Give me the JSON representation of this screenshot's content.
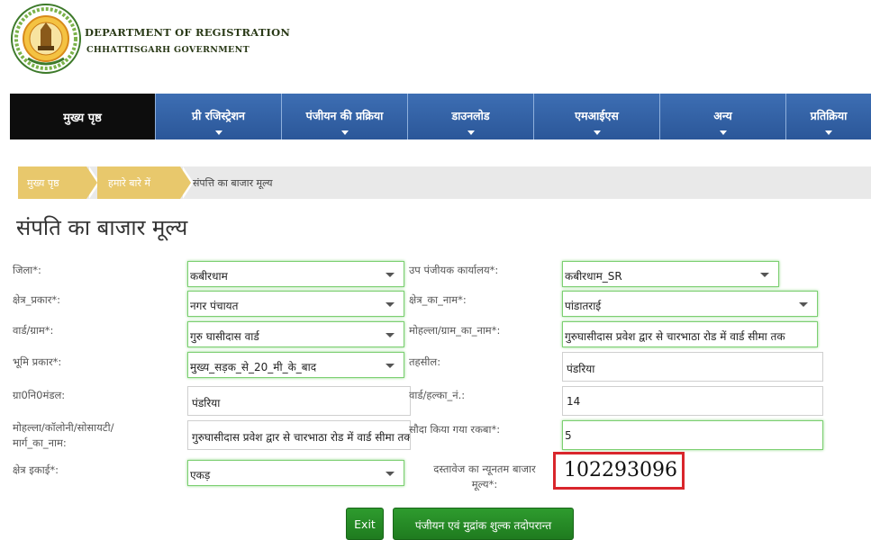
{
  "header": {
    "logo_text": "छत्तीसगढ़ शासन",
    "dept_title": "DEPARTMENT OF REGISTRATION",
    "dept_sub": "CHHATTISGARH GOVERNMENT"
  },
  "nav": {
    "items": [
      {
        "label": "मुख्य पृष्ठ"
      },
      {
        "label": "प्री रजिस्ट्रेशन"
      },
      {
        "label": "पंजीयन की प्रक्रिया"
      },
      {
        "label": "डाउनलोड"
      },
      {
        "label": "एमआईएस"
      },
      {
        "label": "अन्य"
      },
      {
        "label": "प्रतिक्रिया"
      }
    ]
  },
  "breadcrumb": {
    "home": "मुख्य पृष्ठ",
    "about": "हमारे बारे में",
    "current": "संपत्ति का बाजार मूल्य"
  },
  "page_title": "संपति का बाजार मूल्य",
  "form": {
    "district_label": "जिला*:",
    "district_value": "कबीरधाम",
    "sub_registrar_label": "उप पंजीयक कार्यालय*:",
    "sub_registrar_value": "कबीरधाम_SR",
    "area_type_label": "क्षेत्र_प्रकार*:",
    "area_type_value": "नगर पंचायत",
    "area_name_label": "क्षेत्र_का_नाम*:",
    "area_name_value": "पांडातराई",
    "ward_label": "वार्ड/ग्राम*:",
    "ward_value": "गुरु घासीदास वार्ड",
    "mohalla_label": "मोहल्ला/ग्राम_का_नाम*:",
    "mohalla_value": "गुरुघासीदास प्रवेश द्वार से चारभाठा रोड में वार्ड सीमा तक",
    "land_type_label": "भूमि प्रकार*:",
    "land_type_value": "मुख्य_सड़क_से_20_मी_के_बाद",
    "tehsil_label": "तहसील:",
    "tehsil_value": "पंडरिया",
    "village_label": "ग्रा0नि0मंडल:",
    "village_value": "पंडरिया",
    "ward_halka_label": "वार्ड/हल्का_नं.:",
    "ward_halka_value": "14",
    "street_label_1": "मोहल्ला/कॉलोनी/सोसायटी/",
    "street_label_2": "मार्ग_का_नाम:",
    "street_value": "गुरुघासीदास प्रवेश द्वार से चारभाठा रोड में वार्ड सीमा तक",
    "deal_area_label": "सौदा किया गया रकबा*:",
    "deal_area_value": "5",
    "unit_label": "क्षेत्र इकाई*:",
    "unit_value": "एकड़",
    "min_value_label_1": "दस्तावेज का न्यूनतम बाजार",
    "min_value_label_2": "मूल्य*:",
    "min_value": "102293096"
  },
  "buttons": {
    "exit": "Exit",
    "next": "पंजीयन एवं मुद्रांक शुल्क तदोपरान्त"
  },
  "colors": {
    "nav_blue": "#2f5fa6",
    "nav_home": "#0d0d0d",
    "crumb_gold": "#e8c86c",
    "field_green": "#7ccf71",
    "highlight_red": "#d9262c",
    "button_green": "#2a8f2a"
  }
}
